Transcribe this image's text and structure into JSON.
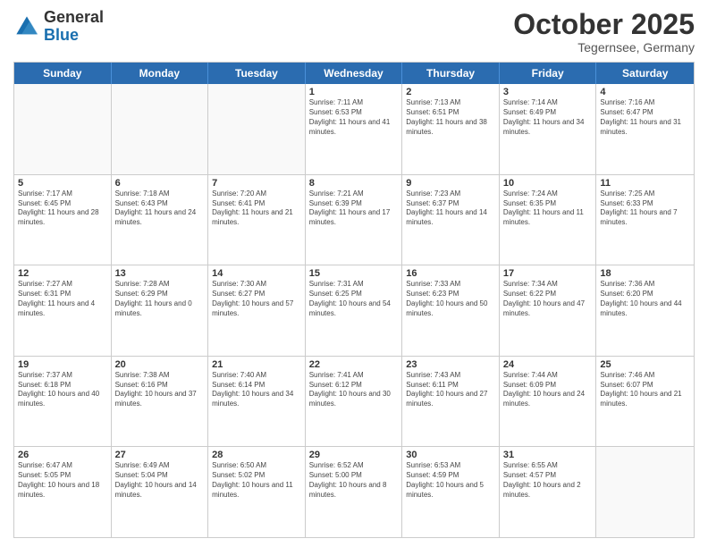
{
  "logo": {
    "general": "General",
    "blue": "Blue"
  },
  "header": {
    "month": "October 2025",
    "location": "Tegernsee, Germany"
  },
  "days": [
    "Sunday",
    "Monday",
    "Tuesday",
    "Wednesday",
    "Thursday",
    "Friday",
    "Saturday"
  ],
  "weeks": [
    [
      {
        "day": "",
        "empty": true
      },
      {
        "day": "",
        "empty": true
      },
      {
        "day": "",
        "empty": true
      },
      {
        "day": "1",
        "sunrise": "Sunrise: 7:11 AM",
        "sunset": "Sunset: 6:53 PM",
        "daylight": "Daylight: 11 hours and 41 minutes."
      },
      {
        "day": "2",
        "sunrise": "Sunrise: 7:13 AM",
        "sunset": "Sunset: 6:51 PM",
        "daylight": "Daylight: 11 hours and 38 minutes."
      },
      {
        "day": "3",
        "sunrise": "Sunrise: 7:14 AM",
        "sunset": "Sunset: 6:49 PM",
        "daylight": "Daylight: 11 hours and 34 minutes."
      },
      {
        "day": "4",
        "sunrise": "Sunrise: 7:16 AM",
        "sunset": "Sunset: 6:47 PM",
        "daylight": "Daylight: 11 hours and 31 minutes."
      }
    ],
    [
      {
        "day": "5",
        "sunrise": "Sunrise: 7:17 AM",
        "sunset": "Sunset: 6:45 PM",
        "daylight": "Daylight: 11 hours and 28 minutes."
      },
      {
        "day": "6",
        "sunrise": "Sunrise: 7:18 AM",
        "sunset": "Sunset: 6:43 PM",
        "daylight": "Daylight: 11 hours and 24 minutes."
      },
      {
        "day": "7",
        "sunrise": "Sunrise: 7:20 AM",
        "sunset": "Sunset: 6:41 PM",
        "daylight": "Daylight: 11 hours and 21 minutes."
      },
      {
        "day": "8",
        "sunrise": "Sunrise: 7:21 AM",
        "sunset": "Sunset: 6:39 PM",
        "daylight": "Daylight: 11 hours and 17 minutes."
      },
      {
        "day": "9",
        "sunrise": "Sunrise: 7:23 AM",
        "sunset": "Sunset: 6:37 PM",
        "daylight": "Daylight: 11 hours and 14 minutes."
      },
      {
        "day": "10",
        "sunrise": "Sunrise: 7:24 AM",
        "sunset": "Sunset: 6:35 PM",
        "daylight": "Daylight: 11 hours and 11 minutes."
      },
      {
        "day": "11",
        "sunrise": "Sunrise: 7:25 AM",
        "sunset": "Sunset: 6:33 PM",
        "daylight": "Daylight: 11 hours and 7 minutes."
      }
    ],
    [
      {
        "day": "12",
        "sunrise": "Sunrise: 7:27 AM",
        "sunset": "Sunset: 6:31 PM",
        "daylight": "Daylight: 11 hours and 4 minutes."
      },
      {
        "day": "13",
        "sunrise": "Sunrise: 7:28 AM",
        "sunset": "Sunset: 6:29 PM",
        "daylight": "Daylight: 11 hours and 0 minutes."
      },
      {
        "day": "14",
        "sunrise": "Sunrise: 7:30 AM",
        "sunset": "Sunset: 6:27 PM",
        "daylight": "Daylight: 10 hours and 57 minutes."
      },
      {
        "day": "15",
        "sunrise": "Sunrise: 7:31 AM",
        "sunset": "Sunset: 6:25 PM",
        "daylight": "Daylight: 10 hours and 54 minutes."
      },
      {
        "day": "16",
        "sunrise": "Sunrise: 7:33 AM",
        "sunset": "Sunset: 6:23 PM",
        "daylight": "Daylight: 10 hours and 50 minutes."
      },
      {
        "day": "17",
        "sunrise": "Sunrise: 7:34 AM",
        "sunset": "Sunset: 6:22 PM",
        "daylight": "Daylight: 10 hours and 47 minutes."
      },
      {
        "day": "18",
        "sunrise": "Sunrise: 7:36 AM",
        "sunset": "Sunset: 6:20 PM",
        "daylight": "Daylight: 10 hours and 44 minutes."
      }
    ],
    [
      {
        "day": "19",
        "sunrise": "Sunrise: 7:37 AM",
        "sunset": "Sunset: 6:18 PM",
        "daylight": "Daylight: 10 hours and 40 minutes."
      },
      {
        "day": "20",
        "sunrise": "Sunrise: 7:38 AM",
        "sunset": "Sunset: 6:16 PM",
        "daylight": "Daylight: 10 hours and 37 minutes."
      },
      {
        "day": "21",
        "sunrise": "Sunrise: 7:40 AM",
        "sunset": "Sunset: 6:14 PM",
        "daylight": "Daylight: 10 hours and 34 minutes."
      },
      {
        "day": "22",
        "sunrise": "Sunrise: 7:41 AM",
        "sunset": "Sunset: 6:12 PM",
        "daylight": "Daylight: 10 hours and 30 minutes."
      },
      {
        "day": "23",
        "sunrise": "Sunrise: 7:43 AM",
        "sunset": "Sunset: 6:11 PM",
        "daylight": "Daylight: 10 hours and 27 minutes."
      },
      {
        "day": "24",
        "sunrise": "Sunrise: 7:44 AM",
        "sunset": "Sunset: 6:09 PM",
        "daylight": "Daylight: 10 hours and 24 minutes."
      },
      {
        "day": "25",
        "sunrise": "Sunrise: 7:46 AM",
        "sunset": "Sunset: 6:07 PM",
        "daylight": "Daylight: 10 hours and 21 minutes."
      }
    ],
    [
      {
        "day": "26",
        "sunrise": "Sunrise: 6:47 AM",
        "sunset": "Sunset: 5:05 PM",
        "daylight": "Daylight: 10 hours and 18 minutes."
      },
      {
        "day": "27",
        "sunrise": "Sunrise: 6:49 AM",
        "sunset": "Sunset: 5:04 PM",
        "daylight": "Daylight: 10 hours and 14 minutes."
      },
      {
        "day": "28",
        "sunrise": "Sunrise: 6:50 AM",
        "sunset": "Sunset: 5:02 PM",
        "daylight": "Daylight: 10 hours and 11 minutes."
      },
      {
        "day": "29",
        "sunrise": "Sunrise: 6:52 AM",
        "sunset": "Sunset: 5:00 PM",
        "daylight": "Daylight: 10 hours and 8 minutes."
      },
      {
        "day": "30",
        "sunrise": "Sunrise: 6:53 AM",
        "sunset": "Sunset: 4:59 PM",
        "daylight": "Daylight: 10 hours and 5 minutes."
      },
      {
        "day": "31",
        "sunrise": "Sunrise: 6:55 AM",
        "sunset": "Sunset: 4:57 PM",
        "daylight": "Daylight: 10 hours and 2 minutes."
      },
      {
        "day": "",
        "empty": true
      }
    ]
  ]
}
